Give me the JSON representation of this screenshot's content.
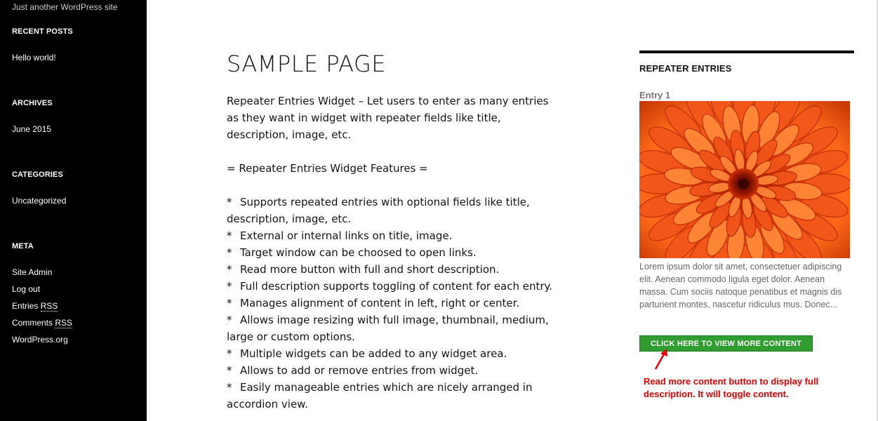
{
  "sidebar": {
    "tagline": "Just another WordPress site",
    "recent_posts": {
      "title": "RECENT POSTS",
      "items": [
        "Hello world!"
      ]
    },
    "archives": {
      "title": "ARCHIVES",
      "items": [
        "June 2015"
      ]
    },
    "categories": {
      "title": "CATEGORIES",
      "items": [
        "Uncategorized"
      ]
    },
    "meta": {
      "title": "META",
      "items": [
        "Site Admin",
        "Log out",
        "Entries ",
        "Comments ",
        "WordPress.org"
      ],
      "rss_abbr": "RSS"
    }
  },
  "main": {
    "title": "SAMPLE PAGE",
    "intro": "Repeater Entries Widget – Let users to enter as many entries as they want in widget with repeater fields like title, description, image, etc.",
    "features_heading": "= Repeater Entries Widget Features =",
    "bullet": "*",
    "features": [
      "Supports repeated entries with optional fields like title, description, image, etc.",
      "External or internal links on title, image.",
      "Target window can be choosed to open links.",
      "Read more button with full and short description.",
      "Full description supports toggling of content for each entry.",
      "Manages alignment of content in left, right or center.",
      "Allows image resizing with full image, thumbnail, medium, large or custom options.",
      "Multiple widgets can be added to any widget area.",
      "Allows to add or remove entries from widget.",
      "Easily manageable entries which are nicely arranged in accordion view."
    ]
  },
  "widget": {
    "title": "REPEATER ENTRIES",
    "entry_title": "Entry 1",
    "entry_image": "orange-flower-image",
    "entry_description": "Lorem ipsum dolor sit amet, consectetuer adipiscing elit. Aenean commodo ligula eget dolor. Aenean massa. Cum sociis natoque penatibus et magnis dis parturient montes, nascetur ridiculus mus. Donec...",
    "button_label": "CLICK HERE TO VIEW MORE CONTENT",
    "button_color": "#2f9d2f",
    "annotation": "Read more content button to display full description. It will toggle content.",
    "annotation_color": "#e00000"
  }
}
